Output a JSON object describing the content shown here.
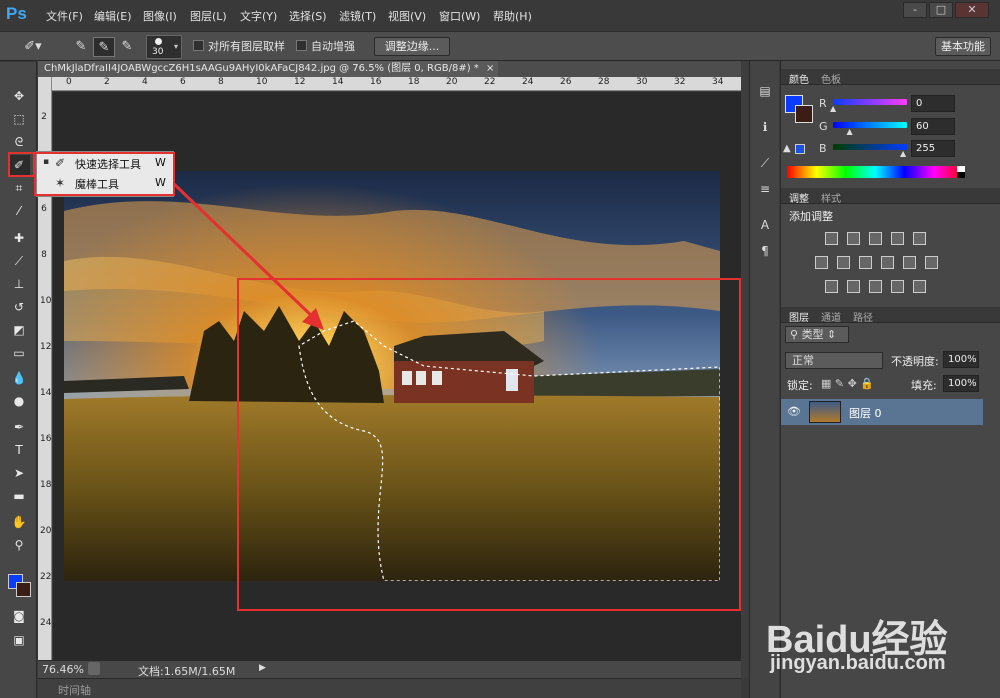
{
  "app": {
    "logo": "Ps"
  },
  "menu": [
    "文件(F)",
    "编辑(E)",
    "图像(I)",
    "图层(L)",
    "文字(Y)",
    "选择(S)",
    "滤镜(T)",
    "视图(V)",
    "窗口(W)",
    "帮助(H)"
  ],
  "window_controls": {
    "minimize": "-",
    "restore": "□",
    "close": "✕"
  },
  "options": {
    "brush_size": "30",
    "sample_all_layers": "对所有图层取样",
    "auto_enhance": "自动增强",
    "refine_edge": "调整边缘...",
    "workspace": "基本功能"
  },
  "document": {
    "tab_title": "ChMkJlaDfraII4JOABWgccZ6H1sAAGu9AHyI0kAFaCJ842.jpg @ 76.5% (图层 0, RGB/8#) *",
    "close": "×"
  },
  "ruler": {
    "top": [
      "0",
      "2",
      "4",
      "6",
      "8",
      "10",
      "12",
      "14",
      "16",
      "18",
      "20",
      "22",
      "24",
      "26",
      "28",
      "30",
      "32",
      "34"
    ],
    "left": [
      "2",
      "4",
      "6",
      "8",
      "10",
      "12",
      "14",
      "16",
      "18",
      "20",
      "22",
      "24"
    ]
  },
  "tool_popup": {
    "items": [
      {
        "bullet": "▪",
        "label": "快速选择工具",
        "key": "W"
      },
      {
        "bullet": "",
        "label": "魔棒工具",
        "key": "W"
      }
    ]
  },
  "status": {
    "zoom": "76.46%",
    "doc": "文档:1.65M/1.65M",
    "timeline": "时间轴"
  },
  "color_panel": {
    "tabs": [
      "颜色",
      "色板"
    ],
    "channels": [
      {
        "label": "R",
        "value": "0",
        "level": 0
      },
      {
        "label": "G",
        "value": "60",
        "level": 0.235
      },
      {
        "label": "B",
        "value": "255",
        "level": 1
      }
    ],
    "foreground": "#0a3cff",
    "background": "#3b1d16"
  },
  "adjust_panel": {
    "tabs": [
      "调整",
      "样式"
    ],
    "title": "添加调整"
  },
  "layers_panel": {
    "tabs": [
      "图层",
      "通道",
      "路径"
    ],
    "filter": "类型",
    "blend": "正常",
    "opacity_label": "不透明度:",
    "opacity": "100%",
    "lock_label": "锁定:",
    "fill_label": "填充:",
    "fill": "100%",
    "layers": [
      {
        "name": "图层 0",
        "visible": true
      }
    ]
  },
  "watermark": {
    "brand": "Baidu经验",
    "url": "jingyan.baidu.com"
  }
}
